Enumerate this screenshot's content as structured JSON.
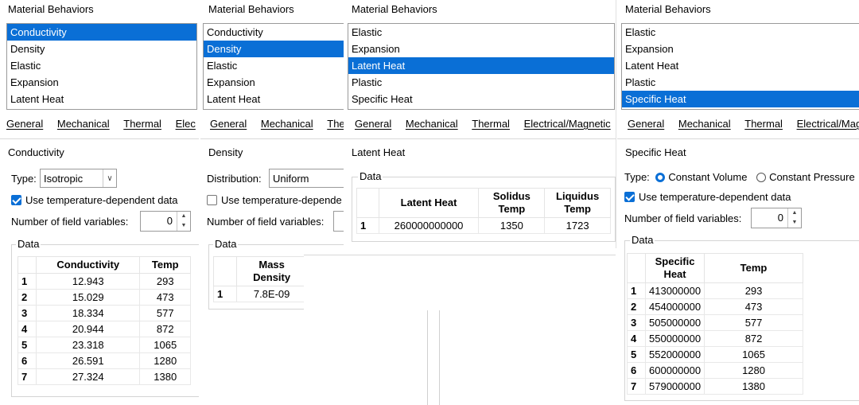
{
  "colors": {
    "selection": "#0a6fd6"
  },
  "panel1": {
    "behaviors_title": "Material Behaviors",
    "behaviors": [
      "Conductivity",
      "Density",
      "Elastic",
      "Expansion",
      "Latent Heat"
    ],
    "tabs": [
      "General",
      "Mechanical",
      "Thermal",
      "Elec"
    ],
    "section_title": "Conductivity",
    "type_label": "Type:",
    "type_value": "Isotropic",
    "use_temp_label": "Use temperature-dependent data",
    "field_vars_label": "Number of field variables:",
    "field_vars_value": "0",
    "data_title": "Data",
    "columns": [
      "Conductivity",
      "Temp"
    ],
    "rows": [
      [
        "1",
        "12.943",
        "293"
      ],
      [
        "2",
        "15.029",
        "473"
      ],
      [
        "3",
        "18.334",
        "577"
      ],
      [
        "4",
        "20.944",
        "872"
      ],
      [
        "5",
        "23.318",
        "1065"
      ],
      [
        "6",
        "26.591",
        "1280"
      ],
      [
        "7",
        "27.324",
        "1380"
      ]
    ]
  },
  "panel2": {
    "behaviors_title": "Material Behaviors",
    "behaviors": [
      "Conductivity",
      "Density",
      "Elastic",
      "Expansion",
      "Latent Heat"
    ],
    "tabs": [
      "General",
      "Mechanical",
      "The"
    ],
    "section_title": "Density",
    "distribution_label": "Distribution:",
    "distribution_value": "Uniform",
    "use_temp_label": "Use temperature-depende",
    "field_vars_label": "Number of field variables:",
    "data_title": "Data",
    "columns": [
      "Mass Density"
    ],
    "rows": [
      [
        "1",
        "7.8E-09"
      ]
    ]
  },
  "panel3": {
    "behaviors_title": "Material Behaviors",
    "behaviors": [
      "Elastic",
      "Expansion",
      "Latent Heat",
      "Plastic",
      "Specific Heat"
    ],
    "tabs": [
      "General",
      "Mechanical",
      "Thermal",
      "Electrical/Magnetic"
    ],
    "section_title": "Latent Heat",
    "data_title": "Data",
    "columns": [
      "Latent Heat",
      "Solidus Temp",
      "Liquidus Temp"
    ],
    "rows": [
      [
        "1",
        "260000000000",
        "1350",
        "1723"
      ]
    ]
  },
  "panel4": {
    "behaviors_title": "Material Behaviors",
    "behaviors": [
      "Elastic",
      "Expansion",
      "Latent Heat",
      "Plastic",
      "Specific Heat"
    ],
    "tabs": [
      "General",
      "Mechanical",
      "Thermal",
      "Electrical/Mag"
    ],
    "section_title": "Specific Heat",
    "type_label": "Type:",
    "radio_const_volume": "Constant Volume",
    "radio_const_pressure": "Constant Pressure",
    "use_temp_label": "Use temperature-dependent data",
    "field_vars_label": "Number of field variables:",
    "field_vars_value": "0",
    "data_title": "Data",
    "columns": [
      "Specific Heat",
      "Temp"
    ],
    "rows": [
      [
        "1",
        "413000000",
        "293"
      ],
      [
        "2",
        "454000000",
        "473"
      ],
      [
        "3",
        "505000000",
        "577"
      ],
      [
        "4",
        "550000000",
        "872"
      ],
      [
        "5",
        "552000000",
        "1065"
      ],
      [
        "6",
        "600000000",
        "1280"
      ],
      [
        "7",
        "579000000",
        "1380"
      ]
    ]
  }
}
